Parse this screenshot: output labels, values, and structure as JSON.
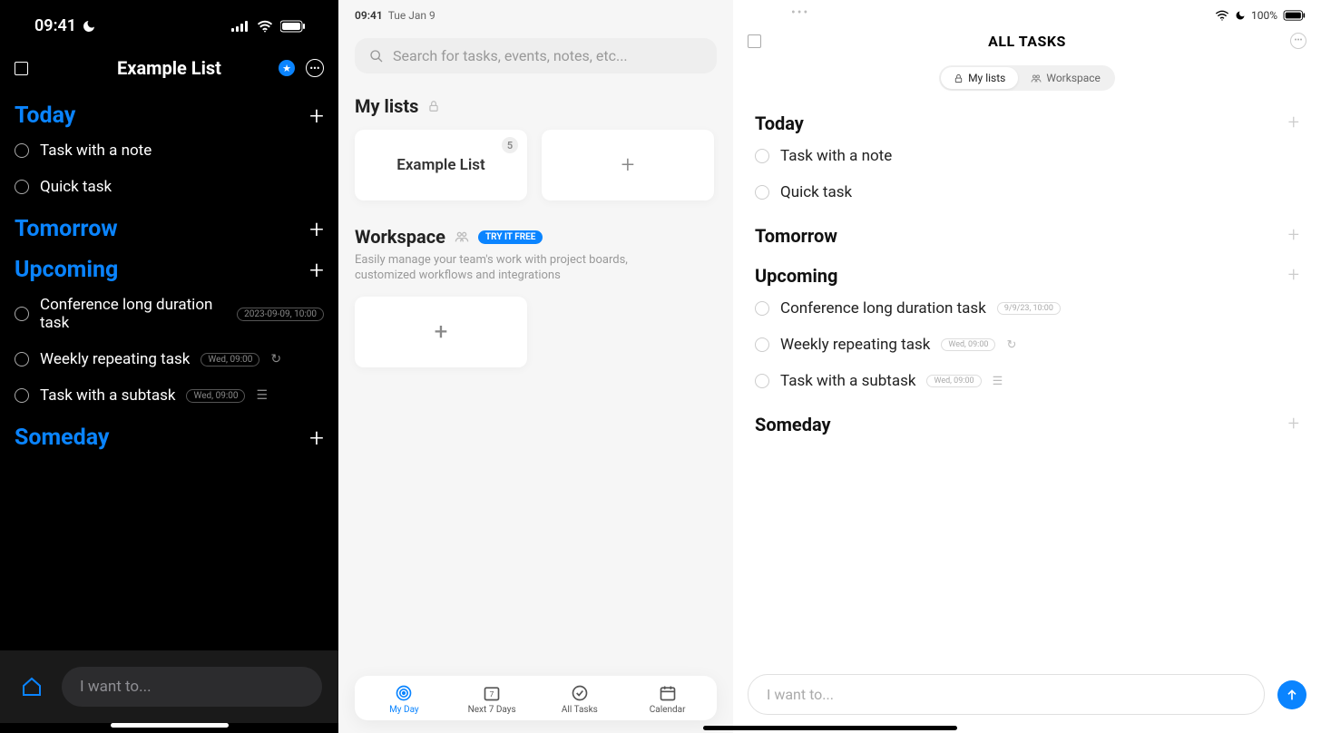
{
  "phone": {
    "status_time": "09:41",
    "header_title": "Example List",
    "sections": {
      "today": "Today",
      "tomorrow": "Tomorrow",
      "upcoming": "Upcoming",
      "someday": "Someday"
    },
    "tasks": {
      "today": [
        {
          "title": "Task with a note"
        },
        {
          "title": "Quick task"
        }
      ],
      "upcoming": [
        {
          "title": "Conference long duration task",
          "pill": "2023-09-09, 10:00"
        },
        {
          "title": "Weekly repeating task",
          "pill": "Wed, 09:00",
          "repeat": true
        },
        {
          "title": "Task with a subtask",
          "pill": "Wed, 09:00",
          "subtask": true
        }
      ]
    },
    "input_placeholder": "I want to..."
  },
  "sidebar": {
    "status_time": "09:41",
    "status_date": "Tue Jan 9",
    "search_placeholder": "Search for tasks, events, notes, etc...",
    "my_lists_title": "My lists",
    "list_card": {
      "name": "Example List",
      "count": "5"
    },
    "workspace_title": "Workspace",
    "try_free": "TRY IT FREE",
    "workspace_desc": "Easily manage your team's work with project boards, customized workflows and integrations",
    "nav": {
      "myday": "My Day",
      "next7": "Next 7 Days",
      "all": "All Tasks",
      "calendar": "Calendar"
    }
  },
  "right": {
    "status_battery": "100%",
    "header_title": "ALL TASKS",
    "seg_mylists": "My lists",
    "seg_workspace": "Workspace",
    "sections": {
      "today": "Today",
      "tomorrow": "Tomorrow",
      "upcoming": "Upcoming",
      "someday": "Someday"
    },
    "tasks": {
      "today": [
        {
          "title": "Task with a note"
        },
        {
          "title": "Quick task"
        }
      ],
      "upcoming": [
        {
          "title": "Conference long duration task",
          "pill": "9/9/23, 10:00"
        },
        {
          "title": "Weekly repeating task",
          "pill": "Wed, 09:00",
          "repeat": true
        },
        {
          "title": "Task with a subtask",
          "pill": "Wed, 09:00",
          "subtask": true
        }
      ]
    },
    "input_placeholder": "I want to..."
  }
}
